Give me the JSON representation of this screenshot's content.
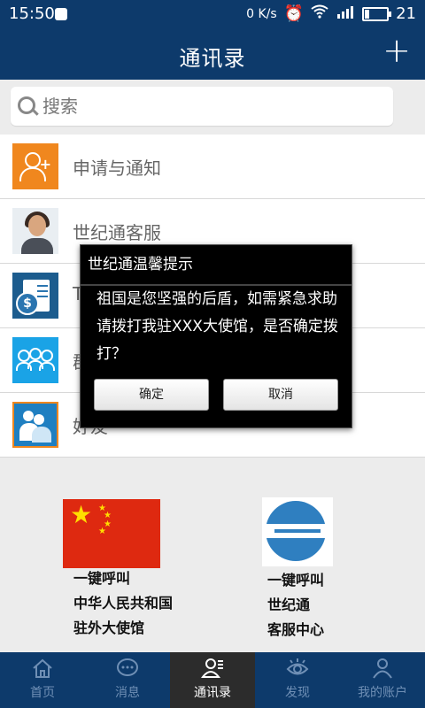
{
  "status_bar": {
    "time": "15:50",
    "net_speed": "0 K/s",
    "battery": "21",
    "battery_fraction": 0.21
  },
  "header": {
    "title": "通讯录",
    "add_glyph": "+"
  },
  "search": {
    "placeholder": "搜索"
  },
  "list": [
    {
      "label": "申请与通知",
      "icon": "add-contact-icon"
    },
    {
      "label": "世纪通客服",
      "icon": "customer-service-avatar"
    },
    {
      "label": "T",
      "icon": "bill-icon"
    },
    {
      "label": "群",
      "icon": "group-icon"
    },
    {
      "label": "好友",
      "icon": "friends-icon"
    }
  ],
  "quick_call": {
    "embassy": {
      "line1": "一键呼叫",
      "line2": "中华人民共和国",
      "line3": "驻外大使馆"
    },
    "service": {
      "line1": "一键呼叫",
      "line2": "世纪通",
      "line3": "客服中心"
    }
  },
  "tabs": [
    {
      "label": "首页",
      "icon": "home-icon"
    },
    {
      "label": "消息",
      "icon": "chat-icon"
    },
    {
      "label": "通讯录",
      "icon": "contacts-icon",
      "active": true
    },
    {
      "label": "发现",
      "icon": "eye-icon"
    },
    {
      "label": "我的账户",
      "icon": "user-icon"
    }
  ],
  "dialog": {
    "title": "世纪通温馨提示",
    "message": "祖国是您坚强的后盾，如需紧急求助请拨打我驻XXX大使馆，是否确定拨打？",
    "confirm": "确定",
    "cancel": "取消"
  }
}
